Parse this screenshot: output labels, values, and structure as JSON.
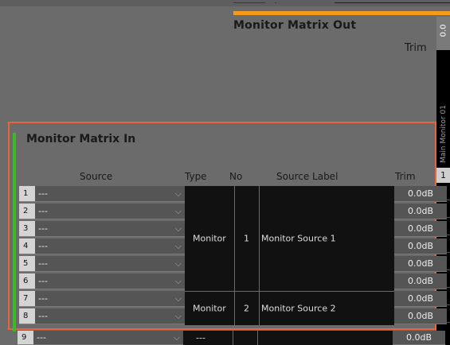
{
  "output": {
    "title": "Monitor Matrix Out",
    "trim_label": "Trim",
    "top_value": "0.0",
    "channel_label": "Main Monitor 01",
    "channel_number": "1"
  },
  "input": {
    "title": "Monitor Matrix In",
    "headers": {
      "source": "Source",
      "type": "Type",
      "no": "No",
      "label": "Source Label",
      "trim": "Trim"
    },
    "rows": [
      {
        "num": "1",
        "source": "---",
        "trim": "0.0dB"
      },
      {
        "num": "2",
        "source": "---",
        "trim": "0.0dB"
      },
      {
        "num": "3",
        "source": "---",
        "trim": "0.0dB"
      },
      {
        "num": "4",
        "source": "---",
        "trim": "0.0dB"
      },
      {
        "num": "5",
        "source": "---",
        "trim": "0.0dB"
      },
      {
        "num": "6",
        "source": "---",
        "trim": "0.0dB"
      },
      {
        "num": "7",
        "source": "---",
        "trim": "0.0dB"
      },
      {
        "num": "8",
        "source": "---",
        "trim": "0.0dB"
      },
      {
        "num": "9",
        "source": "---",
        "trim": "0.0dB",
        "type": "---"
      }
    ],
    "groups": [
      {
        "type": "Monitor",
        "no": "1",
        "label": "Monitor Source 1"
      },
      {
        "type": "Monitor",
        "no": "2",
        "label": "Monitor Source 2"
      }
    ],
    "chevron_glyph": "⌵"
  },
  "colors": {
    "accent_orange": "#f59a1b",
    "panel_border": "#e8643c",
    "green_marker": "#3fb62b"
  }
}
